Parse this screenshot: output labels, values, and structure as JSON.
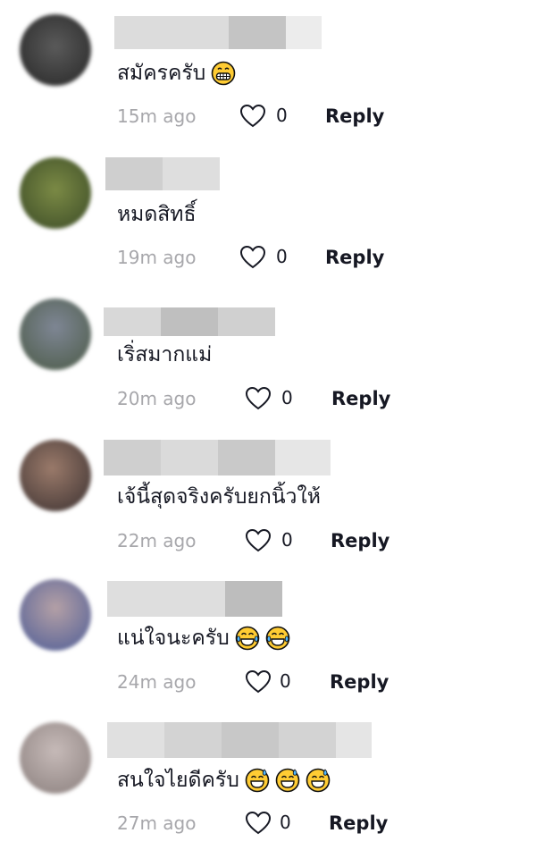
{
  "comments": [
    {
      "time": "15m ago",
      "likes": "0",
      "reply": "Reply",
      "text": "สมัครครับ",
      "emojis": [
        "grinning-teeth-emoji"
      ],
      "avatar_colors": [
        "#4a4a4a",
        "#2b2b2b"
      ],
      "name_blocks": [
        "#dcdcdc",
        "#c4c4c4",
        "#ececec"
      ]
    },
    {
      "time": "19m ago",
      "likes": "0",
      "reply": "Reply",
      "text": "หมดสิทธิ์",
      "emojis": [],
      "avatar_colors": [
        "#6b7a3a",
        "#3f4f2a"
      ],
      "name_blocks": [
        "#cfcfcf",
        "#dedede"
      ]
    },
    {
      "time": "20m ago",
      "likes": "0",
      "reply": "Reply",
      "text": "เริ่สมากแม่",
      "emojis": [],
      "avatar_colors": [
        "#6d7582",
        "#4e5b49"
      ],
      "name_blocks": [
        "#d8d8d8",
        "#bfbfbf",
        "#d0d0d0"
      ]
    },
    {
      "time": "22m ago",
      "likes": "0",
      "reply": "Reply",
      "text": "เจ้นี้สุดจริงครับยกนิ้วให้",
      "emojis": [],
      "avatar_colors": [
        "#8a6a5c",
        "#3e3533"
      ],
      "name_blocks": [
        "#cfcfcf",
        "#dadada",
        "#c9c9c9",
        "#e6e6e6"
      ]
    },
    {
      "time": "24m ago",
      "likes": "0",
      "reply": "Reply",
      "text": "แน่ใจนะครับ",
      "emojis": [
        "tears-of-joy-emoji",
        "tears-of-joy-emoji"
      ],
      "avatar_colors": [
        "#9a8c96",
        "#4f5f9a"
      ],
      "name_blocks": [
        "#dedede",
        "#bdbdbd"
      ]
    },
    {
      "time": "27m ago",
      "likes": "0",
      "reply": "Reply",
      "text": "สนใจไยดีครับ",
      "emojis": [
        "sweat-smile-emoji",
        "sweat-smile-emoji",
        "sweat-smile-emoji"
      ],
      "avatar_colors": [
        "#b7aaa8",
        "#8f8482"
      ],
      "name_blocks": [
        "#e0e0e0",
        "#d3d3d3",
        "#c8c8c8",
        "#e5e5e5"
      ]
    }
  ]
}
